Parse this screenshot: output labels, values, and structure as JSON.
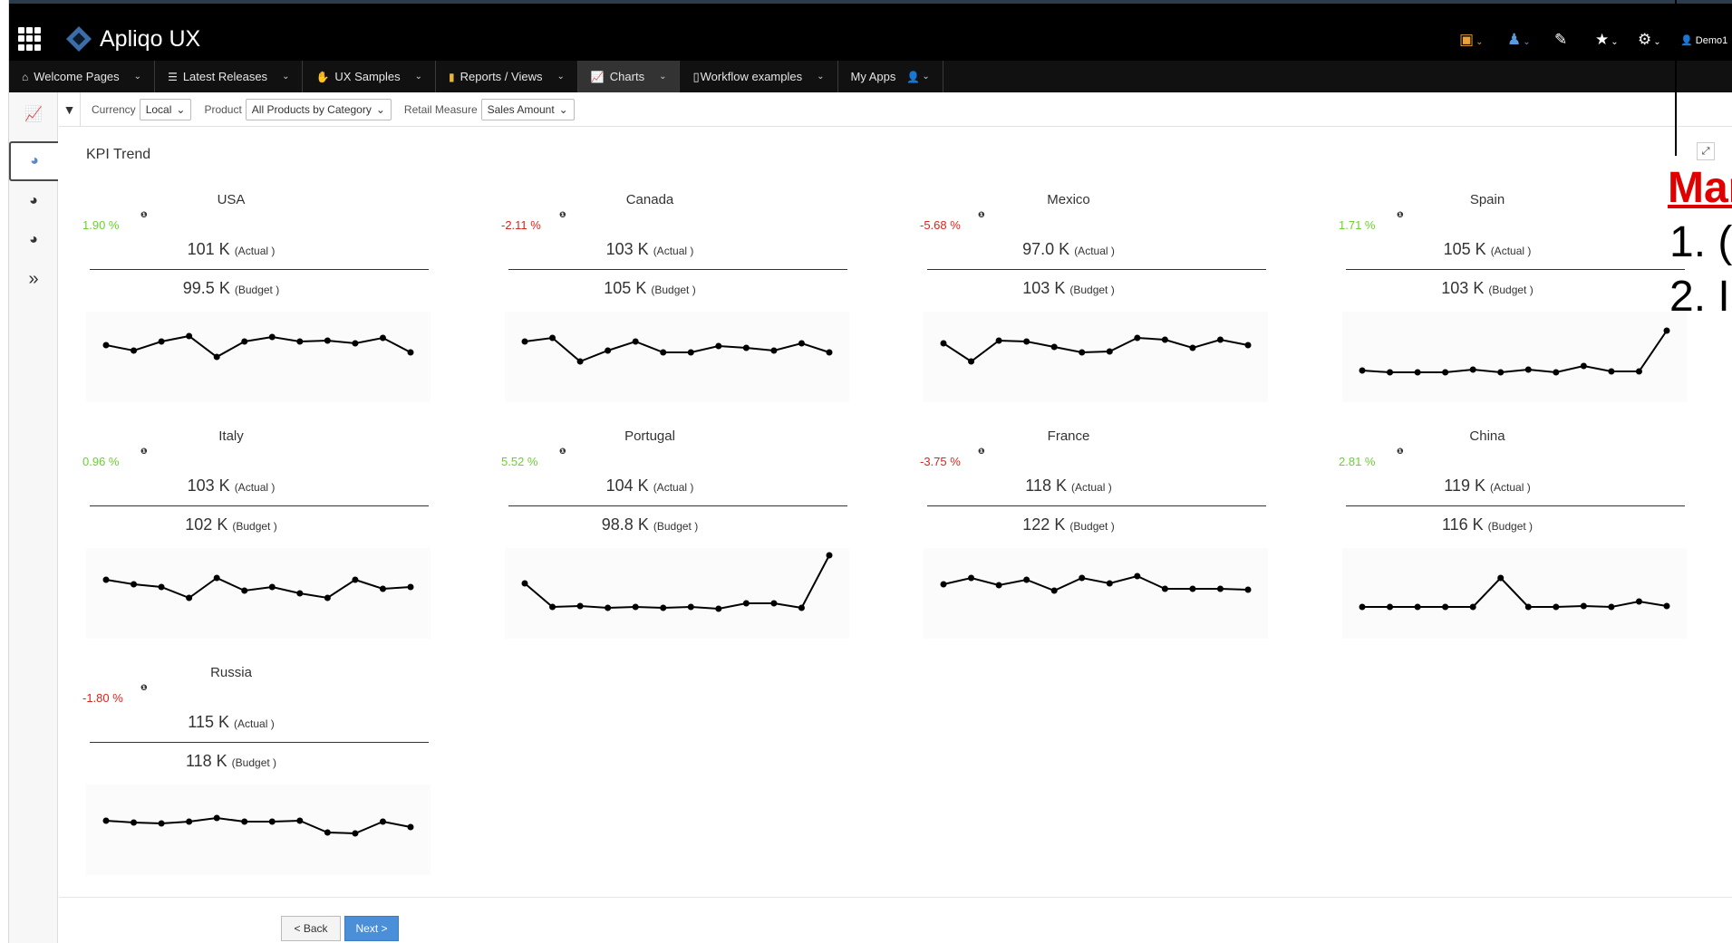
{
  "app": {
    "name": "Apliqo UX"
  },
  "user": {
    "name": "Demo1"
  },
  "nav": {
    "tabs": [
      {
        "label": "Welcome Pages",
        "icon": "home-icon"
      },
      {
        "label": "Latest Releases",
        "icon": "list-icon"
      },
      {
        "label": "UX Samples",
        "icon": "hand-icon"
      },
      {
        "label": "Reports / Views",
        "icon": "book-icon"
      },
      {
        "label": "Charts",
        "icon": "chart-icon"
      },
      {
        "label": "Workflow examples",
        "icon": "missing-glyph-icon"
      },
      {
        "label": "My Apps",
        "icon": "user-icon"
      }
    ]
  },
  "filters": {
    "currency_label": "Currency",
    "currency_value": "Local",
    "product_label": "Product",
    "product_value": "All Products by Category",
    "measure_label": "Retail Measure",
    "measure_value": "Sales Amount"
  },
  "panel": {
    "title": "KPI Trend"
  },
  "kpis": [
    {
      "country": "USA",
      "pct": "1.90 %",
      "pct_color": "#6ad12e",
      "actual": "101 K",
      "budget": "99.5 K",
      "actual_unit": "(Actual )",
      "budget_unit": "(Budget )",
      "trend": [
        58,
        52,
        62,
        68,
        45,
        62,
        67,
        62,
        63,
        60,
        66,
        50
      ]
    },
    {
      "country": "Canada",
      "pct": "-2.11 %",
      "pct_color": "#d9261c",
      "actual": "103 K",
      "budget": "105 K",
      "actual_unit": "(Actual )",
      "budget_unit": "(Budget )",
      "trend": [
        62,
        66,
        40,
        52,
        62,
        50,
        50,
        57,
        55,
        52,
        60,
        50
      ]
    },
    {
      "country": "Mexico",
      "pct": "-5.68 %",
      "pct_color": "#d9261c",
      "actual": "97.0 K",
      "budget": "103 K",
      "actual_unit": "(Actual )",
      "budget_unit": "(Budget )",
      "trend": [
        60,
        40,
        63,
        62,
        56,
        50,
        51,
        66,
        64,
        55,
        64,
        58
      ]
    },
    {
      "country": "Spain",
      "pct": "1.71 %",
      "pct_color": "#6ad12e",
      "actual": "105 K",
      "budget": "103 K",
      "actual_unit": "(Actual )",
      "budget_unit": "(Budget )",
      "trend": [
        30,
        28,
        28,
        28,
        31,
        28,
        31,
        28,
        35,
        29,
        29,
        74
      ]
    },
    {
      "country": "Italy",
      "pct": "0.96 %",
      "pct_color": "#6ad12e",
      "actual": "103 K",
      "budget": "102 K",
      "actual_unit": "(Actual )",
      "budget_unit": "(Budget )",
      "trend": [
        60,
        55,
        52,
        40,
        62,
        48,
        52,
        45,
        40,
        60,
        50,
        52
      ]
    },
    {
      "country": "Portugal",
      "pct": "5.52 %",
      "pct_color": "#6ad12e",
      "actual": "104 K",
      "budget": "98.8 K",
      "actual_unit": "(Actual )",
      "budget_unit": "(Budget )",
      "trend": [
        56,
        30,
        31,
        29,
        30,
        29,
        30,
        28,
        34,
        34,
        29,
        87
      ]
    },
    {
      "country": "France",
      "pct": "-3.75 %",
      "pct_color": "#d9261c",
      "actual": "118 K",
      "budget": "122 K",
      "actual_unit": "(Actual )",
      "budget_unit": "(Budget )",
      "trend": [
        55,
        62,
        54,
        60,
        48,
        62,
        56,
        64,
        50,
        50,
        50,
        49
      ]
    },
    {
      "country": "China",
      "pct": "2.81 %",
      "pct_color": "#6ad12e",
      "actual": "119 K",
      "budget": "116 K",
      "actual_unit": "(Actual )",
      "budget_unit": "(Budget )",
      "trend": [
        30,
        30,
        30,
        30,
        30,
        62,
        30,
        30,
        31,
        30,
        36,
        31
      ]
    },
    {
      "country": "Russia",
      "pct": "-1.80 %",
      "pct_color": "#d9261c",
      "actual": "115 K",
      "budget": "118 K",
      "actual_unit": "(Actual )",
      "budget_unit": "(Budget )",
      "trend": [
        55,
        53,
        52,
        54,
        58,
        54,
        54,
        55,
        42,
        41,
        54,
        48
      ]
    }
  ],
  "footer": {
    "back_label": "< Back",
    "next_label": "Next >"
  },
  "overlay": {
    "title": "Mar",
    "items": [
      "1.  (",
      "2.  I"
    ]
  }
}
